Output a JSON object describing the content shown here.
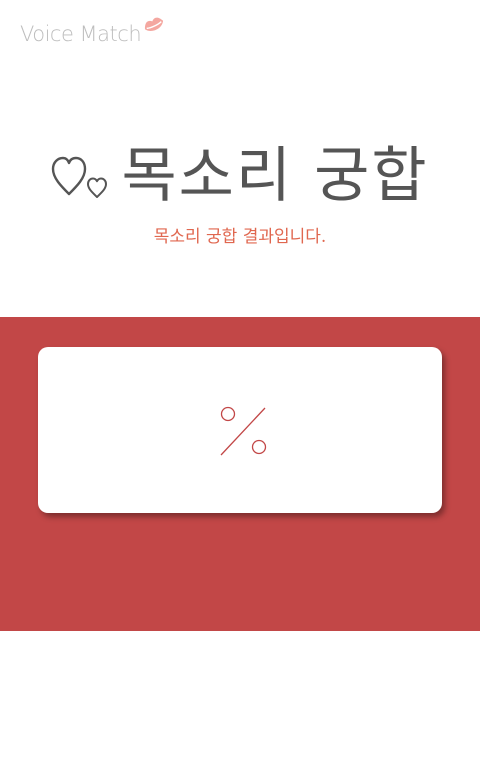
{
  "header": {
    "logo_text": "Voice Match",
    "logo_icon": "lips-icon"
  },
  "hero": {
    "hearts_icon": "hearts-icon",
    "title": "목소리 궁합",
    "subtitle": "목소리 궁합 결과입니다."
  },
  "result": {
    "score": "",
    "unit_icon": "percent-icon"
  },
  "colors": {
    "accent": "#c24747",
    "subtitle": "#e0674f",
    "title": "#555555",
    "logo": "#bdbdbd",
    "lips": "#f4a7a0"
  }
}
